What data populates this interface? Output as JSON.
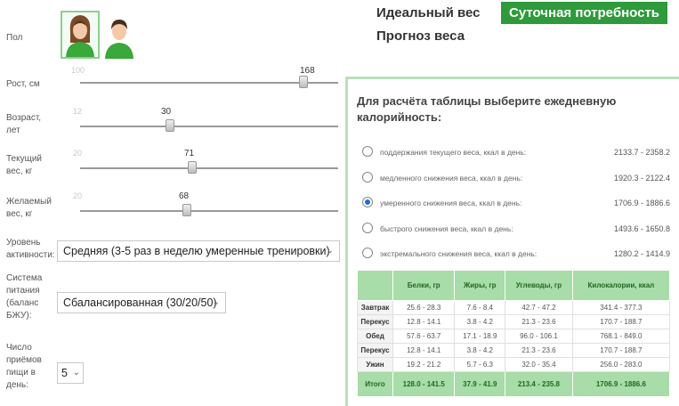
{
  "tabs": [
    {
      "label": "Идеальный вес"
    },
    {
      "label": "Суточная потребность"
    },
    {
      "label": "Прогноз веса"
    }
  ],
  "form": {
    "gender_label": "Пол",
    "height": {
      "label": "Рост, см",
      "min": "100",
      "value": "168"
    },
    "age": {
      "label_line1": "Возраст,",
      "label_line2": "лет",
      "min": "12",
      "value": "30"
    },
    "current_weight": {
      "label_line1": "Текущий",
      "label_line2": "вес, кг",
      "min": "20",
      "value": "71"
    },
    "desired_weight": {
      "label_line1": "Желаемый",
      "label_line2": "вес, кг",
      "min": "20",
      "value": "68"
    },
    "activity": {
      "label_line1": "Уровень",
      "label_line2": "активности:",
      "value": "Средняя (3-5 раз в неделю умеренные тренировки)"
    },
    "diet": {
      "label_line1": "Система",
      "label_line2": "питания",
      "label_line3": "(баланс",
      "label_line4": "БЖУ):",
      "value": "Сбалансированная (30/20/50)"
    },
    "meals": {
      "label_line1": "Число",
      "label_line2": "приёмов",
      "label_line3": "пищи в",
      "label_line4": "день:",
      "value": "5"
    }
  },
  "panel": {
    "title": "Для расчёта таблицы выберите ежедневную калорийность:",
    "options": [
      {
        "label": "поддержания текущего веса, ккал в день:",
        "range": "2133.7 - 2358.2",
        "selected": false
      },
      {
        "label": "медленного снижения веса, ккал в день:",
        "range": "1920.3 - 2122.4",
        "selected": false
      },
      {
        "label": "умеренного снижения веса, ккал в день:",
        "range": "1706.9 - 1886.6",
        "selected": true
      },
      {
        "label": "быстрого снижения веса, ккал в день:",
        "range": "1493.6 - 1650.8",
        "selected": false
      },
      {
        "label": "экстремального снижения веса, ккал в день:",
        "range": "1280.2 - 1414.9",
        "selected": false
      }
    ],
    "table": {
      "headers": [
        "",
        "Белки, гр",
        "Жиры, гр",
        "Углеводы, гр",
        "Килокалории, ккал"
      ],
      "rows": [
        [
          "Завтрак",
          "25.6 - 28.3",
          "7.6 - 8.4",
          "42.7 - 47.2",
          "341.4 - 377.3"
        ],
        [
          "Перекус",
          "12.8 - 14.1",
          "3.8 - 4.2",
          "21.3 - 23.6",
          "170.7 - 188.7"
        ],
        [
          "Обед",
          "57.6 - 63.7",
          "17.1 - 18.9",
          "96.0 - 106.1",
          "768.1 - 849.0"
        ],
        [
          "Перекус",
          "12.8 - 14.1",
          "3.8 - 4.2",
          "21.3 - 23.6",
          "170.7 - 188.7"
        ],
        [
          "Ужин",
          "19.2 - 21.2",
          "5.7 - 6.3",
          "32.0 - 35.4",
          "256.0 - 283.0"
        ]
      ],
      "total": [
        "Итого",
        "128.0 - 141.5",
        "37.9 - 41.9",
        "213.4 - 235.8",
        "1706.9 - 1886.6"
      ]
    }
  },
  "colors": {
    "accent": "#2e9a3c",
    "table_header": "#a8dca8",
    "panel_border": "#b9e0b9"
  },
  "icons": [
    "female-avatar-icon",
    "male-avatar-icon",
    "chevron-down-icon"
  ]
}
